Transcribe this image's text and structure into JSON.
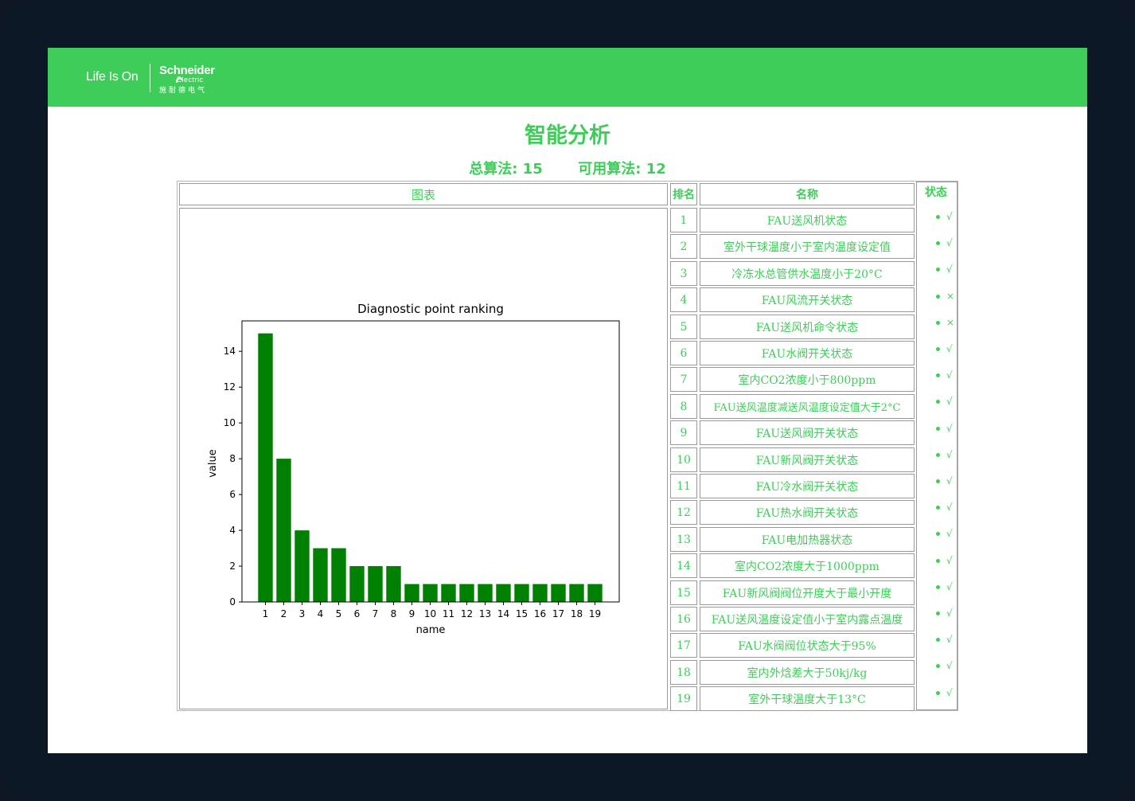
{
  "brand": {
    "life_is_on": "Life Is On",
    "name": "Schneider",
    "sub": "Electric",
    "cn": "施耐德电气"
  },
  "page": {
    "title": "智能分析",
    "total_label": "总算法: 15",
    "available_label": "可用算法: 12"
  },
  "table": {
    "headers": {
      "chart": "图表",
      "rank": "排名",
      "name": "名称",
      "status": "状态"
    },
    "rows": [
      {
        "rank": "1",
        "name": "FAU送风机状态",
        "status": "√"
      },
      {
        "rank": "2",
        "name": "室外干球温度小于室内温度设定值",
        "status": "√"
      },
      {
        "rank": "3",
        "name": "冷冻水总管供水温度小于20°C",
        "status": "√"
      },
      {
        "rank": "4",
        "name": "FAU风流开关状态",
        "status": "×"
      },
      {
        "rank": "5",
        "name": "FAU送风机命令状态",
        "status": "×"
      },
      {
        "rank": "6",
        "name": "FAU水阀开关状态",
        "status": "√"
      },
      {
        "rank": "7",
        "name": "室内CO2浓度小于800ppm",
        "status": "√"
      },
      {
        "rank": "8",
        "name": "FAU送风温度减送风温度设定值大于2°C",
        "status": "√"
      },
      {
        "rank": "9",
        "name": "FAU送风阀开关状态",
        "status": "√"
      },
      {
        "rank": "10",
        "name": "FAU新风阀开关状态",
        "status": "√"
      },
      {
        "rank": "11",
        "name": "FAU冷水阀开关状态",
        "status": "√"
      },
      {
        "rank": "12",
        "name": "FAU热水阀开关状态",
        "status": "√"
      },
      {
        "rank": "13",
        "name": "FAU电加热器状态",
        "status": "√"
      },
      {
        "rank": "14",
        "name": "室内CO2浓度大于1000ppm",
        "status": "√"
      },
      {
        "rank": "15",
        "name": "FAU新风阀阀位开度大于最小开度",
        "status": "√"
      },
      {
        "rank": "16",
        "name": "FAU送风温度设定值小于室内露点温度",
        "status": "√"
      },
      {
        "rank": "17",
        "name": "FAU水阀阀位状态大于95%",
        "status": "√"
      },
      {
        "rank": "18",
        "name": "室内外焓差大于50kj/kg",
        "status": "√"
      },
      {
        "rank": "19",
        "name": "室外干球温度大于13°C",
        "status": "√"
      }
    ]
  },
  "colors": {
    "brand_green": "#3dcd58",
    "bar_green": "#008000"
  },
  "chart_data": {
    "type": "bar",
    "title": "Diagnostic point ranking",
    "xlabel": "name",
    "ylabel": "value",
    "categories": [
      "1",
      "2",
      "3",
      "4",
      "5",
      "6",
      "7",
      "8",
      "9",
      "10",
      "11",
      "12",
      "13",
      "14",
      "15",
      "16",
      "17",
      "18",
      "19"
    ],
    "values": [
      15,
      8,
      4,
      3,
      3,
      2,
      2,
      2,
      1,
      1,
      1,
      1,
      1,
      1,
      1,
      1,
      1,
      1,
      1
    ],
    "yticks": [
      0,
      2,
      4,
      6,
      8,
      10,
      12,
      14
    ],
    "ylim": [
      0,
      15.7
    ],
    "grid": false
  }
}
